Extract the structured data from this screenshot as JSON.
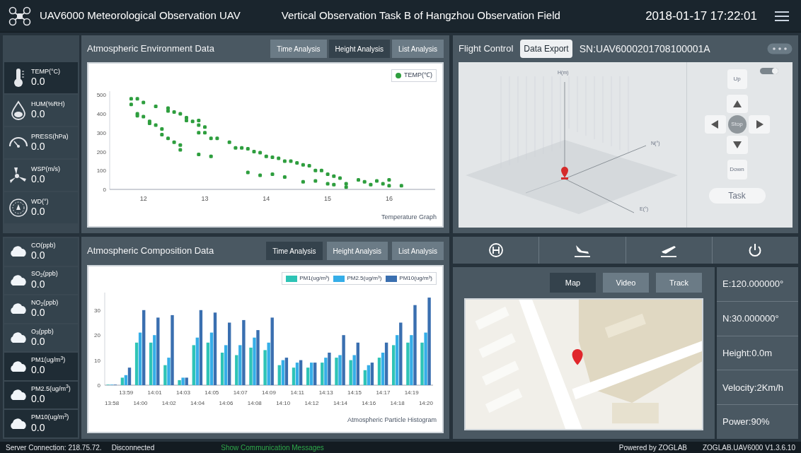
{
  "header": {
    "title": "UAV6000 Meteorological Observation UAV",
    "task": "Vertical Observation Task B of Hangzhou Observation Field",
    "datetime": "2018-01-17 17:22:01"
  },
  "sensors_top": [
    {
      "label": "TEMP(°C)",
      "value": "0.0",
      "selected": true
    },
    {
      "label": "HUM(%RH)",
      "value": "0.0",
      "selected": false
    },
    {
      "label": "PRESS(hPa)",
      "value": "0.0",
      "selected": false
    },
    {
      "label": "WSP(m/s)",
      "value": "0.0",
      "selected": false
    },
    {
      "label": "WD(°)",
      "value": "0.0",
      "selected": false
    }
  ],
  "environment_panel": {
    "title": "Atmospheric Environment Data",
    "tabs": [
      {
        "label": "Time Analysis",
        "selected": false
      },
      {
        "label": "Height Analysis",
        "selected": true
      },
      {
        "label": "List Analysis",
        "selected": false
      }
    ],
    "chart_data": {
      "type": "scatter",
      "title": "Temperature Graph",
      "legend": "top right",
      "xlim": [
        11.45,
        16.75
      ],
      "ylim": [
        0,
        520
      ],
      "xticks": [
        12,
        13,
        14,
        15,
        16
      ],
      "yticks": [
        0,
        100,
        200,
        300,
        400,
        500
      ],
      "series": [
        {
          "name": "TEMP(℃)",
          "color": "#2e9e3e",
          "x": [
            11.8,
            11.8,
            11.9,
            11.9,
            11.9,
            12.0,
            12.0,
            12.1,
            12.1,
            12.2,
            12.2,
            12.3,
            12.3,
            12.4,
            12.4,
            12.4,
            12.5,
            12.5,
            12.6,
            12.6,
            12.6,
            12.7,
            12.7,
            12.8,
            12.9,
            12.9,
            12.9,
            12.9,
            13.0,
            13.0,
            13.1,
            13.1,
            13.2,
            13.4,
            13.5,
            13.6,
            13.7,
            13.7,
            13.8,
            13.9,
            13.9,
            14.0,
            14.1,
            14.1,
            14.2,
            14.3,
            14.3,
            14.4,
            14.5,
            14.6,
            14.6,
            14.7,
            14.8,
            14.8,
            14.9,
            15.0,
            15.0,
            15.1,
            15.1,
            15.2,
            15.3,
            15.3,
            15.5,
            15.6,
            15.7,
            15.8,
            15.9,
            16.0,
            16.0,
            16.2
          ],
          "values": [
            480,
            450,
            480,
            400,
            390,
            460,
            385,
            360,
            350,
            440,
            340,
            320,
            290,
            430,
            415,
            270,
            410,
            250,
            400,
            235,
            210,
            380,
            365,
            360,
            365,
            340,
            300,
            185,
            330,
            300,
            270,
            175,
            270,
            250,
            220,
            220,
            215,
            90,
            200,
            195,
            75,
            175,
            170,
            80,
            165,
            150,
            65,
            150,
            140,
            130,
            40,
            125,
            100,
            45,
            100,
            80,
            30,
            70,
            25,
            60,
            30,
            12,
            50,
            40,
            25,
            45,
            30,
            50,
            20,
            20
          ]
        }
      ]
    }
  },
  "sensors_bottom": [
    {
      "label": "CO(ppb)",
      "value": "0.0",
      "kind": "gas"
    },
    {
      "label": "SO$_{2}$(ppb)",
      "value": "0.0",
      "kind": "gas"
    },
    {
      "label": "NO$_{2}$(ppb)",
      "value": "0.0",
      "kind": "gas"
    },
    {
      "label": "O$_{3}$(ppb)",
      "value": "0.0",
      "kind": "gas"
    },
    {
      "label": "PM1(ug/m$^{3}$)",
      "value": "0.0",
      "kind": "particle"
    },
    {
      "label": "PM2.5(ug/m$^{3}$)",
      "value": "0.0",
      "kind": "particle"
    },
    {
      "label": "PM10(ug/m$^{3}$)",
      "value": "0.0",
      "kind": "particle"
    }
  ],
  "composition_panel": {
    "title": "Atmospheric Composition Data",
    "tabs": [
      {
        "label": "Time Analysis",
        "selected": true
      },
      {
        "label": "Height Analysis",
        "selected": false
      },
      {
        "label": "List Analysis",
        "selected": false
      }
    ],
    "chart_data": {
      "type": "bar",
      "title": "Atmospheric Particle Histogram",
      "legend": "top right",
      "ylim": [
        0,
        37
      ],
      "yticks": [
        0,
        10,
        20,
        30
      ],
      "categories": [
        "13:58",
        "13:59",
        "14:00",
        "14:01",
        "14:02",
        "14:03",
        "14:04",
        "14:05",
        "14:06",
        "14:07",
        "14:08",
        "14:09",
        "14:10",
        "14:11",
        "14:12",
        "14:13",
        "14:14",
        "14:15",
        "14:16",
        "14:17",
        "14:18",
        "14:19",
        "14:20"
      ],
      "series": [
        {
          "name": "PM1(ug/m³)",
          "color": "#2ec4b6",
          "values": [
            0.2,
            3,
            17,
            17,
            8,
            2,
            16,
            17,
            13,
            12,
            15,
            14,
            8,
            7,
            7,
            9,
            11,
            10,
            6,
            11,
            16,
            17,
            17
          ]
        },
        {
          "name": "PM2.5(ug/m³)",
          "color": "#35aee8",
          "values": [
            0.2,
            4,
            21,
            20,
            11,
            3,
            19,
            21,
            16,
            16,
            19,
            17,
            10,
            9,
            9,
            11,
            12,
            12,
            8,
            13,
            20,
            20,
            21
          ]
        },
        {
          "name": "PM10(ug/m³)",
          "color": "#3a6fb0",
          "values": [
            0.2,
            7,
            30,
            27,
            28,
            3,
            30,
            29,
            25,
            26,
            22,
            27,
            11,
            10,
            9,
            13,
            20,
            17,
            9,
            17,
            25,
            32,
            35
          ]
        }
      ]
    }
  },
  "flight_panel": {
    "title": "Flight Control",
    "export_button": "Data Export",
    "serial": "SN:UAV6000201708100001A",
    "axes": [
      "H(m)",
      "N(°)",
      "E(°)"
    ],
    "toggle": {
      "on": true
    },
    "dpad": {
      "up": "Up",
      "stop": "Stop",
      "down": "Down",
      "task": "Task"
    }
  },
  "map_tabs": [
    {
      "label": "Map",
      "selected": true
    },
    {
      "label": "Video",
      "selected": false
    },
    {
      "label": "Track",
      "selected": false
    }
  ],
  "position": [
    "E:120.000000°",
    "N:30.000000°",
    "Height:0.0m",
    "Velocity:2Km/h",
    "Power:90%"
  ],
  "status_bar": {
    "connection": "Server Connection: 218.75.72.",
    "state": "Disconnected",
    "messages_link": "Show Communication Messages",
    "powered": "Powered by ZOGLAB",
    "version": "ZOGLAB.UAV6000 V1.3.6.10"
  }
}
